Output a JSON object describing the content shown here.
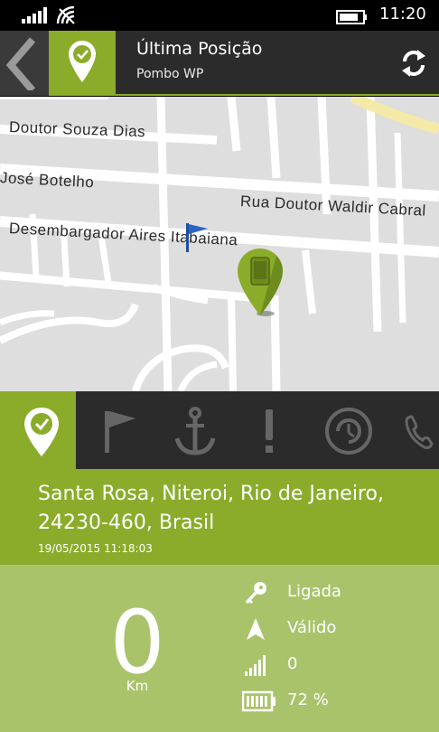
{
  "statusbar": {
    "time": "11:20",
    "icons": [
      "signal-icon",
      "wifi-icon",
      "battery-icon"
    ]
  },
  "header": {
    "title": "Última Posição",
    "subtitle": "Pombo WP",
    "back_icon": "chevron-left-icon",
    "pin_icon": "location-check-icon",
    "refresh_icon": "refresh-icon"
  },
  "map": {
    "streets": [
      "Doutor Souza Dias",
      "José Botelho",
      "Rua Doutor Waldir Cabral",
      "Desembargador Aires Itabaiana"
    ],
    "markers": [
      "flag-marker",
      "device-pin-marker"
    ]
  },
  "tabs": [
    {
      "icon": "location-check-icon",
      "active": true
    },
    {
      "icon": "flag-icon",
      "active": false
    },
    {
      "icon": "anchor-icon",
      "active": false
    },
    {
      "icon": "alert-icon",
      "active": false
    },
    {
      "icon": "history-clock-icon",
      "active": false
    },
    {
      "icon": "phone-icon",
      "active": false
    }
  ],
  "address": {
    "text": "Santa Rosa, Niteroi, Rio de Janeiro, 24230-460, Brasil",
    "datetime": "19/05/2015 11:18:03"
  },
  "speed": {
    "value": "0",
    "unit": "Km"
  },
  "status": {
    "ignition": "Ligada",
    "gps": "Válido",
    "signal": "0",
    "battery": "72 %"
  },
  "colors": {
    "accent": "#8aac2a",
    "panel": "#a9c36b",
    "dark": "#2b2b2b"
  }
}
